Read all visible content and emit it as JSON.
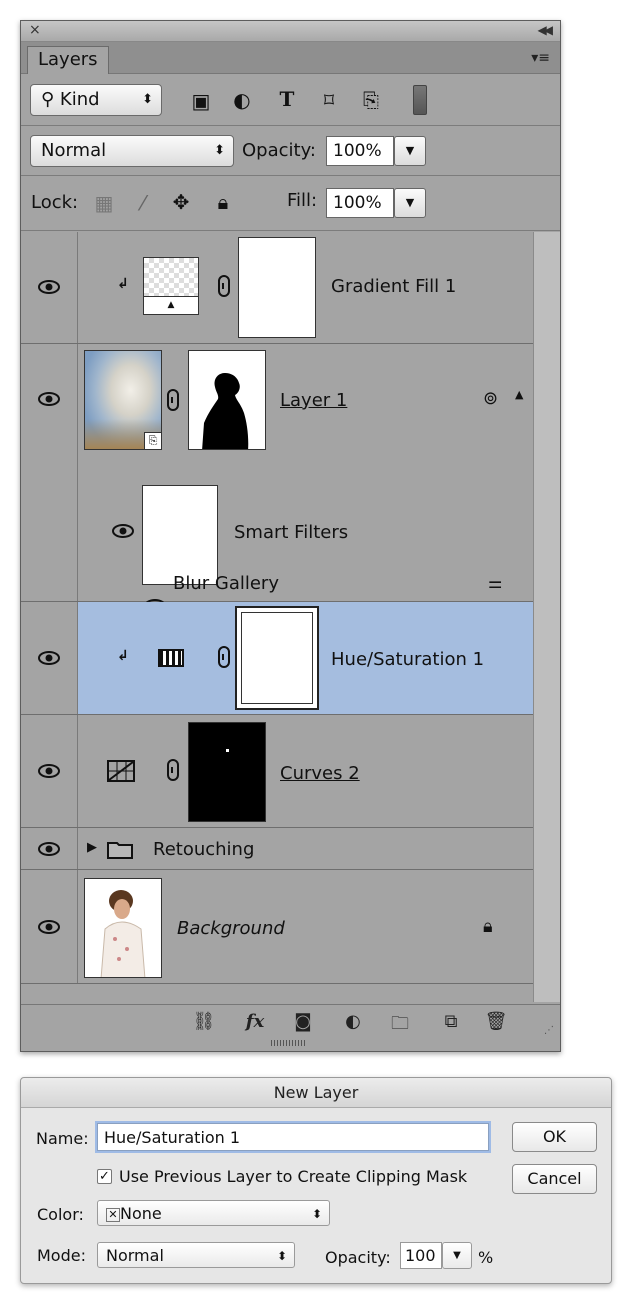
{
  "panel": {
    "close_icon": "close-icon",
    "tab_label": "Layers",
    "kind_label": "Kind",
    "blend_mode": "Normal",
    "opacity_label": "Opacity:",
    "opacity_value": "100%",
    "lock_label": "Lock:",
    "fill_label": "Fill:",
    "fill_value": "100%"
  },
  "layers": {
    "gradient_fill": "Gradient Fill 1",
    "layer1": "Layer 1",
    "smart_filters": "Smart Filters",
    "blur_gallery": "Blur Gallery",
    "hue_sat": "Hue/Saturation 1",
    "curves": "Curves 2",
    "retouching": "Retouching",
    "background": "Background"
  },
  "colors": {
    "selected_row": "#a5bddf",
    "panel_bg": "#a4a4a4"
  },
  "dialog": {
    "title": "New Layer",
    "name_label": "Name:",
    "name_value": "Hue/Saturation 1",
    "ok_label": "OK",
    "cancel_label": "Cancel",
    "clip_label": "Use Previous Layer to Create Clipping Mask",
    "clip_checked": true,
    "color_label": "Color:",
    "color_value": "None",
    "mode_label": "Mode:",
    "mode_value": "Normal",
    "opacity_label": "Opacity:",
    "opacity_value": "100",
    "percent": "%"
  }
}
